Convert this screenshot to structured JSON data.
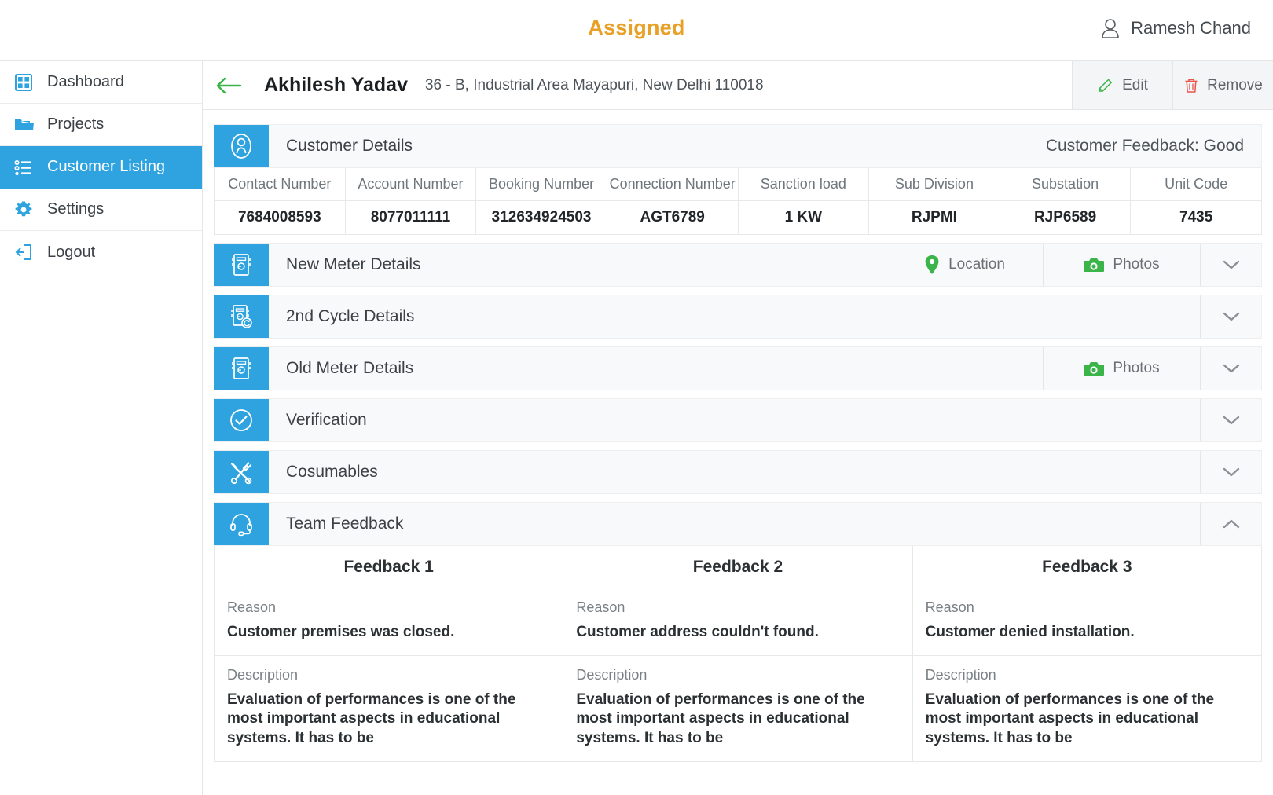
{
  "header": {
    "title": "Assigned",
    "user_name": "Ramesh Chand",
    "user_icon": "user-icon"
  },
  "sidebar": {
    "items": [
      {
        "label": "Dashboard",
        "icon": "dashboard-grid-icon",
        "active": false
      },
      {
        "label": "Projects",
        "icon": "folder-icon",
        "active": false
      },
      {
        "label": "Customer Listing",
        "icon": "list-icon",
        "active": true
      },
      {
        "label": "Settings",
        "icon": "gear-icon",
        "active": false
      },
      {
        "label": "Logout",
        "icon": "logout-icon",
        "active": false
      }
    ]
  },
  "page_head": {
    "back_icon": "arrow-left-icon",
    "customer_name": "Akhilesh Yadav",
    "address": "36 - B, Industrial Area Mayapuri, New Delhi 110018",
    "edit_label": "Edit",
    "edit_icon": "pencil-icon",
    "remove_label": "Remove",
    "remove_icon": "trash-icon"
  },
  "sections": {
    "customer_details": {
      "title": "Customer Details",
      "icon": "customer-avatar-icon",
      "feedback_text": "Customer Feedback: Good",
      "table": {
        "headers": [
          "Contact Number",
          "Account Number",
          "Booking Number",
          "Connection Number",
          "Sanction load",
          "Sub Division",
          "Substation",
          "Unit Code"
        ],
        "values": [
          "7684008593",
          "8077011111",
          "312634924503",
          "AGT6789",
          "1 KW",
          "RJPMI",
          "RJP6589",
          "7435"
        ]
      }
    },
    "new_meter": {
      "title": "New Meter Details",
      "icon": "meter-icon",
      "location_label": "Location",
      "location_icon": "map-pin-icon",
      "photos_label": "Photos",
      "photos_icon": "camera-icon",
      "chevron": "chevron-down-icon"
    },
    "second_cycle": {
      "title": "2nd Cycle Details",
      "icon": "meter-refresh-icon",
      "chevron": "chevron-down-icon"
    },
    "old_meter": {
      "title": "Old Meter Details",
      "icon": "meter-icon",
      "photos_label": "Photos",
      "photos_icon": "camera-icon",
      "chevron": "chevron-down-icon"
    },
    "verification": {
      "title": "Verification",
      "icon": "check-circle-icon",
      "chevron": "chevron-down-icon"
    },
    "cosumables": {
      "title": "Cosumables",
      "icon": "tools-icon",
      "chevron": "chevron-down-icon"
    },
    "team_feedback": {
      "title": "Team Feedback",
      "icon": "headset-icon",
      "chevron": "chevron-up-icon",
      "columns": [
        {
          "title": "Feedback 1",
          "reason_label": "Reason",
          "reason": "Customer premises was closed.",
          "description_label": "Description",
          "description": "Evaluation of performances is one of the most important aspects in educational systems. It has to be"
        },
        {
          "title": "Feedback 2",
          "reason_label": "Reason",
          "reason": "Customer address couldn't found.",
          "description_label": "Description",
          "description": "Evaluation of performances is one of the most important aspects in educational systems. It has to be"
        },
        {
          "title": "Feedback 3",
          "reason_label": "Reason",
          "reason": "Customer denied installation.",
          "description_label": "Description",
          "description": "Evaluation of performances is one of the most important aspects in educational systems. It has to be"
        }
      ]
    }
  },
  "colors": {
    "brand_blue": "#2ea3e0",
    "accent_orange": "#e8a126",
    "green": "#3bb54a",
    "red": "#e8544a"
  }
}
